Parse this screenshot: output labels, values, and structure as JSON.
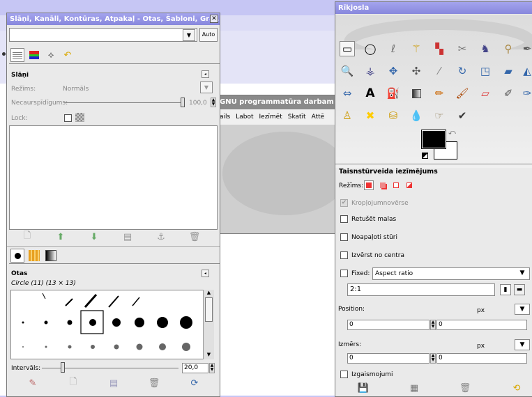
{
  "layers_window": {
    "title": "Slāņi, Kanāli, Kontūras, Atpakaļ - Otas, Šabloni, Gra...",
    "close": "✕",
    "auto_label": "Auto",
    "layers": {
      "title": "Slāņi",
      "mode_label": "Režīms:",
      "mode_value": "Normāls",
      "opacity_label": "Necaurspīdīgums:",
      "opacity_value": "100,0",
      "lock_label": "Lock:",
      "opacity": 1.0
    },
    "brushes": {
      "title": "Otas",
      "subtitle": "Circle (11) (13 × 13)",
      "interval_label": "Intervāls:",
      "interval_value": "20,0",
      "interval": 0.2
    }
  },
  "gimp_main": {
    "title": "GNU programmatūra darbam a",
    "menu": [
      "ails",
      "Labot",
      "Iezīmēt",
      "Skatīt",
      "Attē"
    ]
  },
  "toolbox": {
    "title": "Rīkjosla",
    "options_title": "Taisnstūrveida iezīmējums",
    "mode_label": "Režīms:",
    "crop_label": "Kropļojumnovērse",
    "feather_label": "Retušēt malas",
    "round_label": "Noapaļoti stūri",
    "center_label": "Izvērst no centra",
    "fixed_label": "Fixed:",
    "fixed_value": "Aspect ratio",
    "ratio_value": "2:1",
    "position_label": "Position:",
    "position_unit": "px",
    "pos_x": "0",
    "pos_y": "0",
    "size_label": "Izmērs:",
    "size_unit": "px",
    "size_w": "0",
    "size_h": "0",
    "highlight_label": "Izgaismojumi"
  }
}
